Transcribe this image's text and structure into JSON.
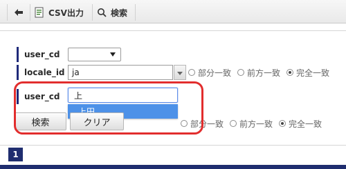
{
  "toolbar": {
    "csv_label": "CSV出力",
    "search_label": "検索"
  },
  "form": {
    "row1": {
      "label": "user_cd",
      "selected_value": ""
    },
    "row2": {
      "label": "locale_id",
      "value": "ja",
      "match_options": [
        "部分一致",
        "前方一致",
        "完全一致"
      ],
      "selected_match": "完全一致"
    },
    "row3": {
      "label": "user_cd",
      "value": "上",
      "match_options": [
        "部分一致",
        "前方一致",
        "完全一致"
      ],
      "selected_match": "完全一致",
      "suggestion": "上田"
    }
  },
  "buttons": {
    "search": "検索",
    "clear": "クリア"
  },
  "pager": {
    "current_page": "1"
  },
  "colors": {
    "accent_navy": "#1f2d6f",
    "highlight_red": "#e22d2d",
    "suggestion_blue": "#4d91e8"
  }
}
